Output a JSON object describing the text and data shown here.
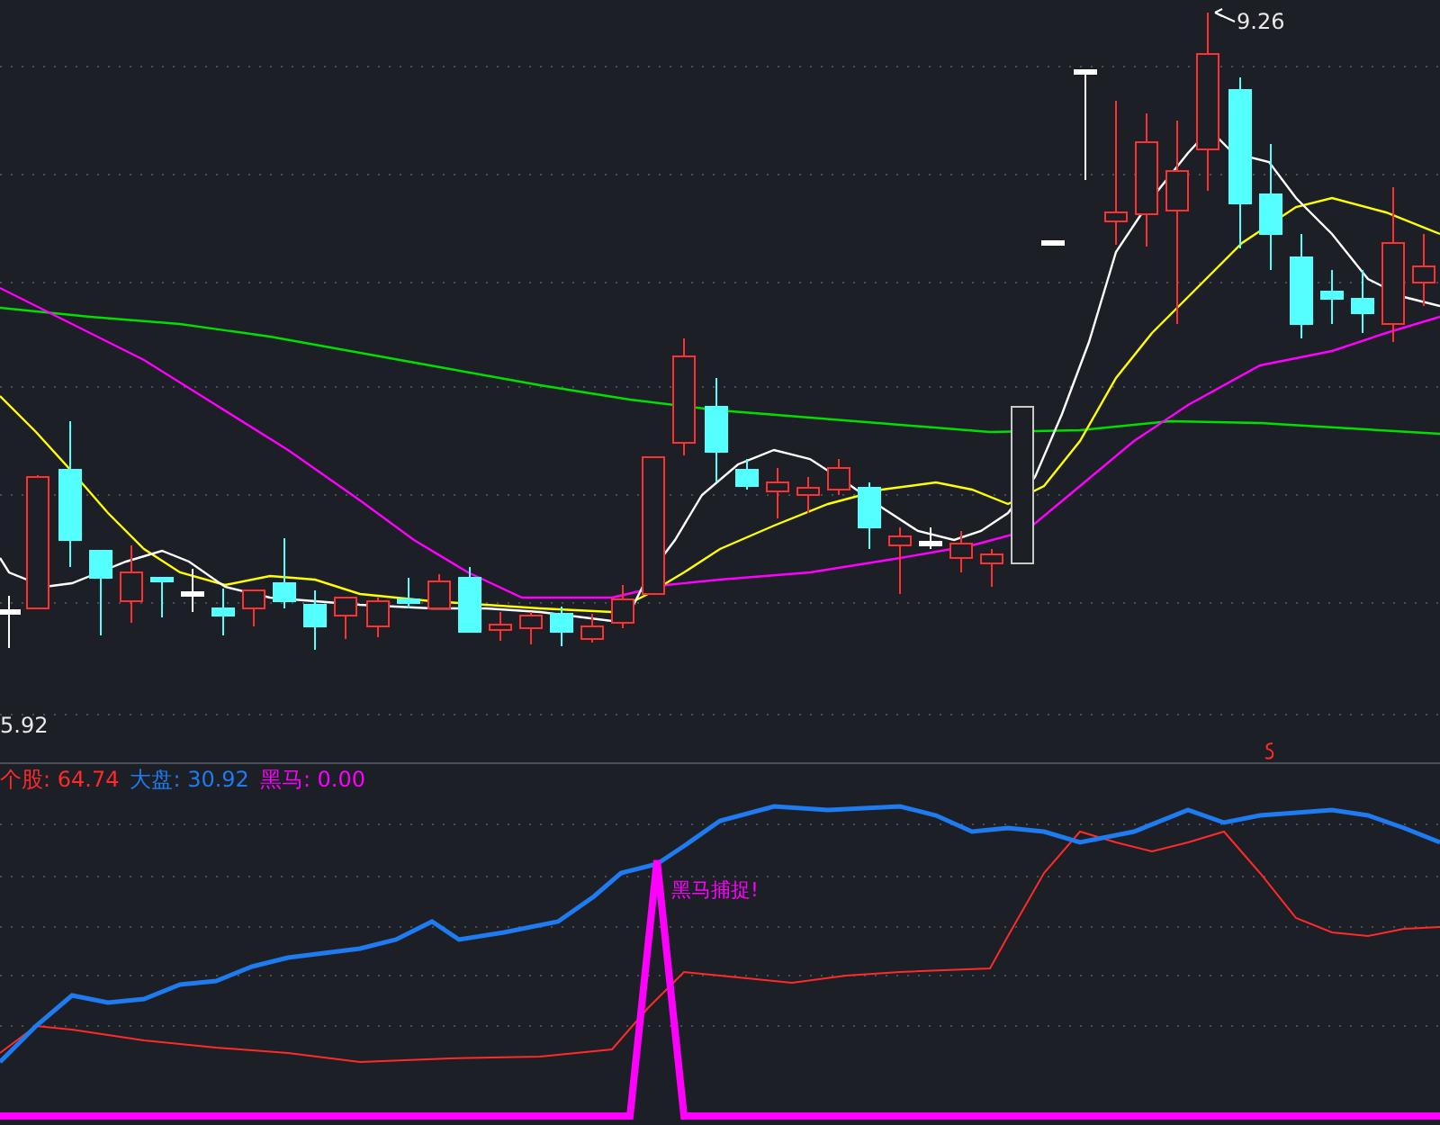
{
  "price_panel": {
    "high_label": "9.26",
    "low_label": "5.92"
  },
  "indicator_panel": {
    "legend": [
      {
        "name": "个股:",
        "value": "64.74",
        "color": "#ff2a2a"
      },
      {
        "name": "大盘:",
        "value": "30.92",
        "color": "#1e7bf0"
      },
      {
        "name": "黑马:",
        "value": "0.00",
        "color": "#ff00ff"
      }
    ],
    "signal_label": "黑马捕捉!"
  }
}
